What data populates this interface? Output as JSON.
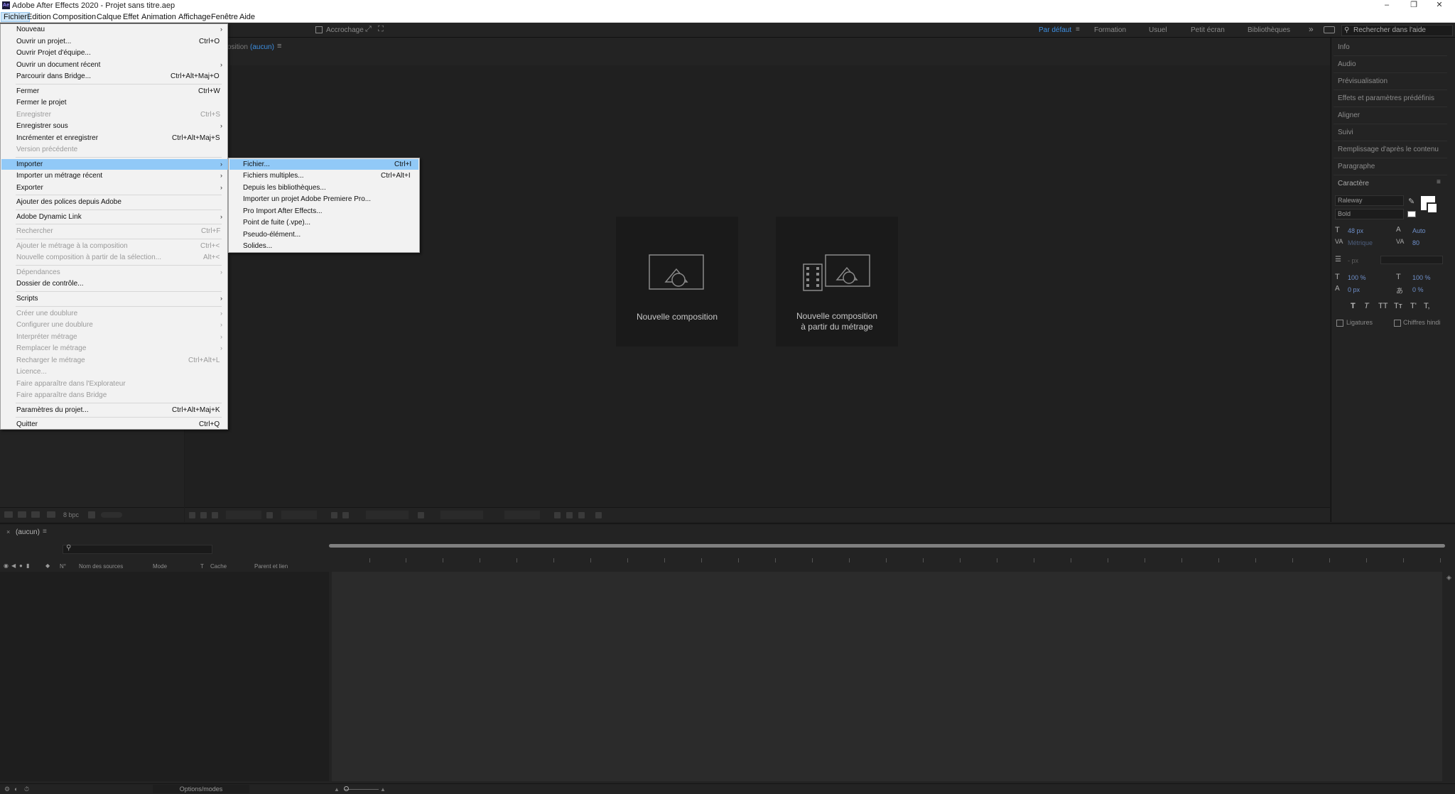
{
  "window": {
    "title": "Adobe After Effects 2020 - Projet sans titre.aep",
    "logo": "Ae",
    "minimize": "–",
    "restore": "❐",
    "close": "✕"
  },
  "menubar": [
    "Fichier",
    "Edition",
    "Composition",
    "Calque",
    "Effet",
    "Animation",
    "Affichage",
    "Fenêtre",
    "Aide"
  ],
  "toolbar": {
    "snap_label": "Accrochage",
    "workspaces": [
      "Par défaut",
      "Formation",
      "Usuel",
      "Petit écran",
      "Bibliothèques"
    ],
    "more": "»",
    "help_placeholder": "Rechercher dans l'aide"
  },
  "comp_panel": {
    "tab_prefix": "osition",
    "tab_name": "(aucun)",
    "menu_glyph": "≡",
    "card_new": "Nouvelle composition",
    "card_from_line1": "Nouvelle composition",
    "card_from_line2": "à partir du métrage"
  },
  "project_bottom": {
    "bpc": "8 bpc"
  },
  "right_panel": {
    "items": [
      "Info",
      "Audio",
      "Prévisualisation",
      "Effets et paramètres prédéfinis",
      "Aligner",
      "Suivi",
      "Remplissage d'après le contenu",
      "Paragraphe"
    ],
    "character": {
      "title": "Caractère",
      "font": "Raleway",
      "style": "Bold",
      "size": "48 px",
      "leading": "Auto",
      "kerning": "Métrique",
      "tracking": "80",
      "stroke": "- px",
      "vscale": "100 %",
      "hscale": "100 %",
      "baseline": "0 px",
      "tsume": "0 %",
      "styles": [
        "T",
        "T",
        "TT",
        "Tт",
        "T'",
        "T,"
      ],
      "ligatures": "Ligatures",
      "hindi": "Chiffres hindi"
    }
  },
  "timeline": {
    "tab": "(aucun)",
    "columns": [
      "N°",
      "Nom des sources",
      "Mode",
      "T",
      "Cache",
      "Parent et lien"
    ],
    "footer": "Options/modes"
  },
  "file_menu": {
    "items": [
      {
        "label": "Nouveau",
        "shortcut": "",
        "arrow": true,
        "disabled": false
      },
      {
        "label": "Ouvrir un projet...",
        "shortcut": "Ctrl+O",
        "arrow": false,
        "disabled": false
      },
      {
        "label": "Ouvrir Projet d'équipe...",
        "shortcut": "",
        "arrow": false,
        "disabled": false
      },
      {
        "label": "Ouvrir un document récent",
        "shortcut": "",
        "arrow": true,
        "disabled": false
      },
      {
        "label": "Parcourir dans Bridge...",
        "shortcut": "Ctrl+Alt+Maj+O",
        "arrow": false,
        "disabled": false
      },
      {
        "label": "Fermer",
        "shortcut": "Ctrl+W",
        "arrow": false,
        "disabled": false
      },
      {
        "label": "Fermer le projet",
        "shortcut": "",
        "arrow": false,
        "disabled": false
      },
      {
        "label": "Enregistrer",
        "shortcut": "Ctrl+S",
        "arrow": false,
        "disabled": true
      },
      {
        "label": "Enregistrer sous",
        "shortcut": "",
        "arrow": true,
        "disabled": false
      },
      {
        "label": "Incrémenter et enregistrer",
        "shortcut": "Ctrl+Alt+Maj+S",
        "arrow": false,
        "disabled": false
      },
      {
        "label": "Version précédente",
        "shortcut": "",
        "arrow": false,
        "disabled": true
      },
      {
        "label": "Importer",
        "shortcut": "",
        "arrow": true,
        "disabled": false,
        "highlight": true
      },
      {
        "label": "Importer un métrage récent",
        "shortcut": "",
        "arrow": true,
        "disabled": false
      },
      {
        "label": "Exporter",
        "shortcut": "",
        "arrow": true,
        "disabled": false
      },
      {
        "label": "Ajouter des polices depuis Adobe",
        "shortcut": "",
        "arrow": false,
        "disabled": false
      },
      {
        "label": "Adobe Dynamic Link",
        "shortcut": "",
        "arrow": true,
        "disabled": false
      },
      {
        "label": "Rechercher",
        "shortcut": "Ctrl+F",
        "arrow": false,
        "disabled": true
      },
      {
        "label": "Ajouter le métrage à la composition",
        "shortcut": "Ctrl+<",
        "arrow": false,
        "disabled": true
      },
      {
        "label": "Nouvelle composition à partir de la sélection...",
        "shortcut": "Alt+<",
        "arrow": false,
        "disabled": true
      },
      {
        "label": "Dépendances",
        "shortcut": "",
        "arrow": true,
        "disabled": true
      },
      {
        "label": "Dossier de contrôle...",
        "shortcut": "",
        "arrow": false,
        "disabled": false
      },
      {
        "label": "Scripts",
        "shortcut": "",
        "arrow": true,
        "disabled": false
      },
      {
        "label": "Créer une doublure",
        "shortcut": "",
        "arrow": true,
        "disabled": true
      },
      {
        "label": "Configurer une doublure",
        "shortcut": "",
        "arrow": true,
        "disabled": true
      },
      {
        "label": "Interpréter métrage",
        "shortcut": "",
        "arrow": true,
        "disabled": true
      },
      {
        "label": "Remplacer le métrage",
        "shortcut": "",
        "arrow": true,
        "disabled": true
      },
      {
        "label": "Recharger le métrage",
        "shortcut": "Ctrl+Alt+L",
        "arrow": false,
        "disabled": true
      },
      {
        "label": "Licence...",
        "shortcut": "",
        "arrow": false,
        "disabled": true
      },
      {
        "label": "Faire apparaître dans l'Explorateur",
        "shortcut": "",
        "arrow": false,
        "disabled": true
      },
      {
        "label": "Faire apparaître dans Bridge",
        "shortcut": "",
        "arrow": false,
        "disabled": true
      },
      {
        "label": "Paramètres du projet...",
        "shortcut": "Ctrl+Alt+Maj+K",
        "arrow": false,
        "disabled": false
      },
      {
        "label": "Quitter",
        "shortcut": "Ctrl+Q",
        "arrow": false,
        "disabled": false
      }
    ]
  },
  "import_submenu": {
    "items": [
      {
        "label": "Fichier...",
        "shortcut": "Ctrl+I",
        "highlight": true
      },
      {
        "label": "Fichiers multiples...",
        "shortcut": "Ctrl+Alt+I"
      },
      {
        "label": "Depuis les bibliothèques...",
        "shortcut": ""
      },
      {
        "label": "Importer un projet Adobe Premiere Pro...",
        "shortcut": ""
      },
      {
        "label": "Pro Import After Effects...",
        "shortcut": ""
      },
      {
        "label": "Point de fuite (.vpe)...",
        "shortcut": ""
      },
      {
        "label": "Pseudo-élément...",
        "shortcut": ""
      },
      {
        "label": "Solides...",
        "shortcut": ""
      }
    ]
  },
  "colors": {
    "accent": "#3d8ee0",
    "menu_highlight": "#91c9f7",
    "menubar_active": "#cce4f7"
  }
}
